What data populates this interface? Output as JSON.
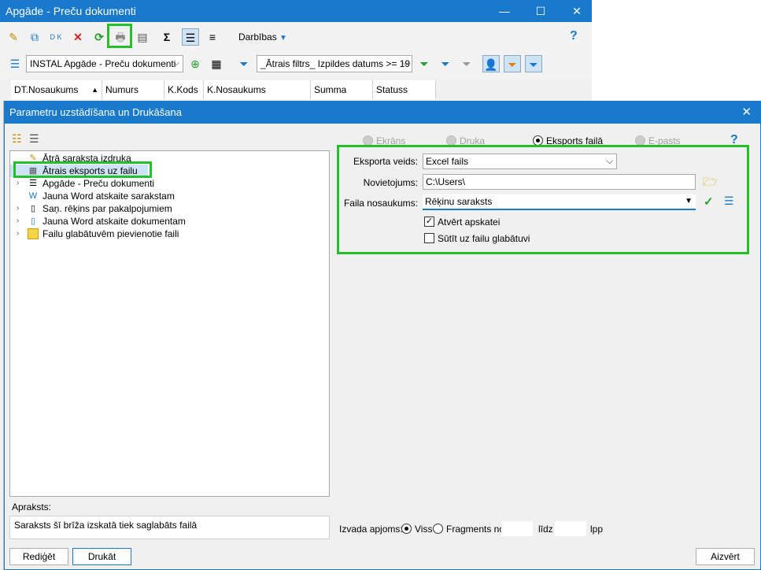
{
  "bg_window": {
    "title": "Apgāde - Preču dokumenti",
    "minimize": "—",
    "maximize": "☐",
    "close": "✕",
    "actions_label": "Darbības",
    "help": "?",
    "list_combo": "INSTAL Apgāde - Preču dokumenti",
    "filter_combo": "_Ātrais filtrs_ Izpildes datums >= 19",
    "columns": [
      "DT.Nosaukums",
      "Numurs",
      "K.Kods",
      "K.Nosaukums",
      "Summa",
      "Statuss"
    ]
  },
  "dialog": {
    "title": "Parametru uzstādīšana un Drukāšana",
    "close": "✕",
    "help": "?",
    "tree": [
      {
        "label": "Ātrā saraksta izdruka",
        "expandable": false
      },
      {
        "label": "Ātrais eksports uz failu",
        "expandable": false
      },
      {
        "label": "Apgāde - Preču dokumenti",
        "expandable": true
      },
      {
        "label": "Jauna Word atskaite sarakstam",
        "expandable": false
      },
      {
        "label": "Saņ. rēķins par pakalpojumiem",
        "expandable": true
      },
      {
        "label": "Jauna Word atskaite dokumentam",
        "expandable": true
      },
      {
        "label": "Failu glabātuvēm pievienotie faili",
        "expandable": true
      }
    ],
    "output_modes": {
      "screen": "Ekrāns",
      "print": "Druka",
      "export": "Eksports failā",
      "email": "E-pasts"
    },
    "export_form": {
      "type_label": "Eksporta veids:",
      "type_value": "Excel fails",
      "location_label": "Novietojums:",
      "location_value": "C:\\Users\\",
      "filename_label": "Faila nosaukums:",
      "filename_value": "Rēķinu saraksts",
      "open_label": "Atvērt apskatei",
      "open_checked": true,
      "send_label": "Sūtīt uz failu glabātuvi",
      "send_checked": false
    },
    "description_label": "Apraksts:",
    "description_text": "Saraksts šī brīža izskatā tiek saglabāts failā",
    "scope": {
      "label": "Izvada apjoms:",
      "all": "Viss",
      "fragment": "Fragments no",
      "to": "līdz",
      "pages": "lpp"
    },
    "buttons": {
      "edit": "Rediģēt",
      "print": "Drukāt",
      "close": "Aizvērt"
    }
  }
}
